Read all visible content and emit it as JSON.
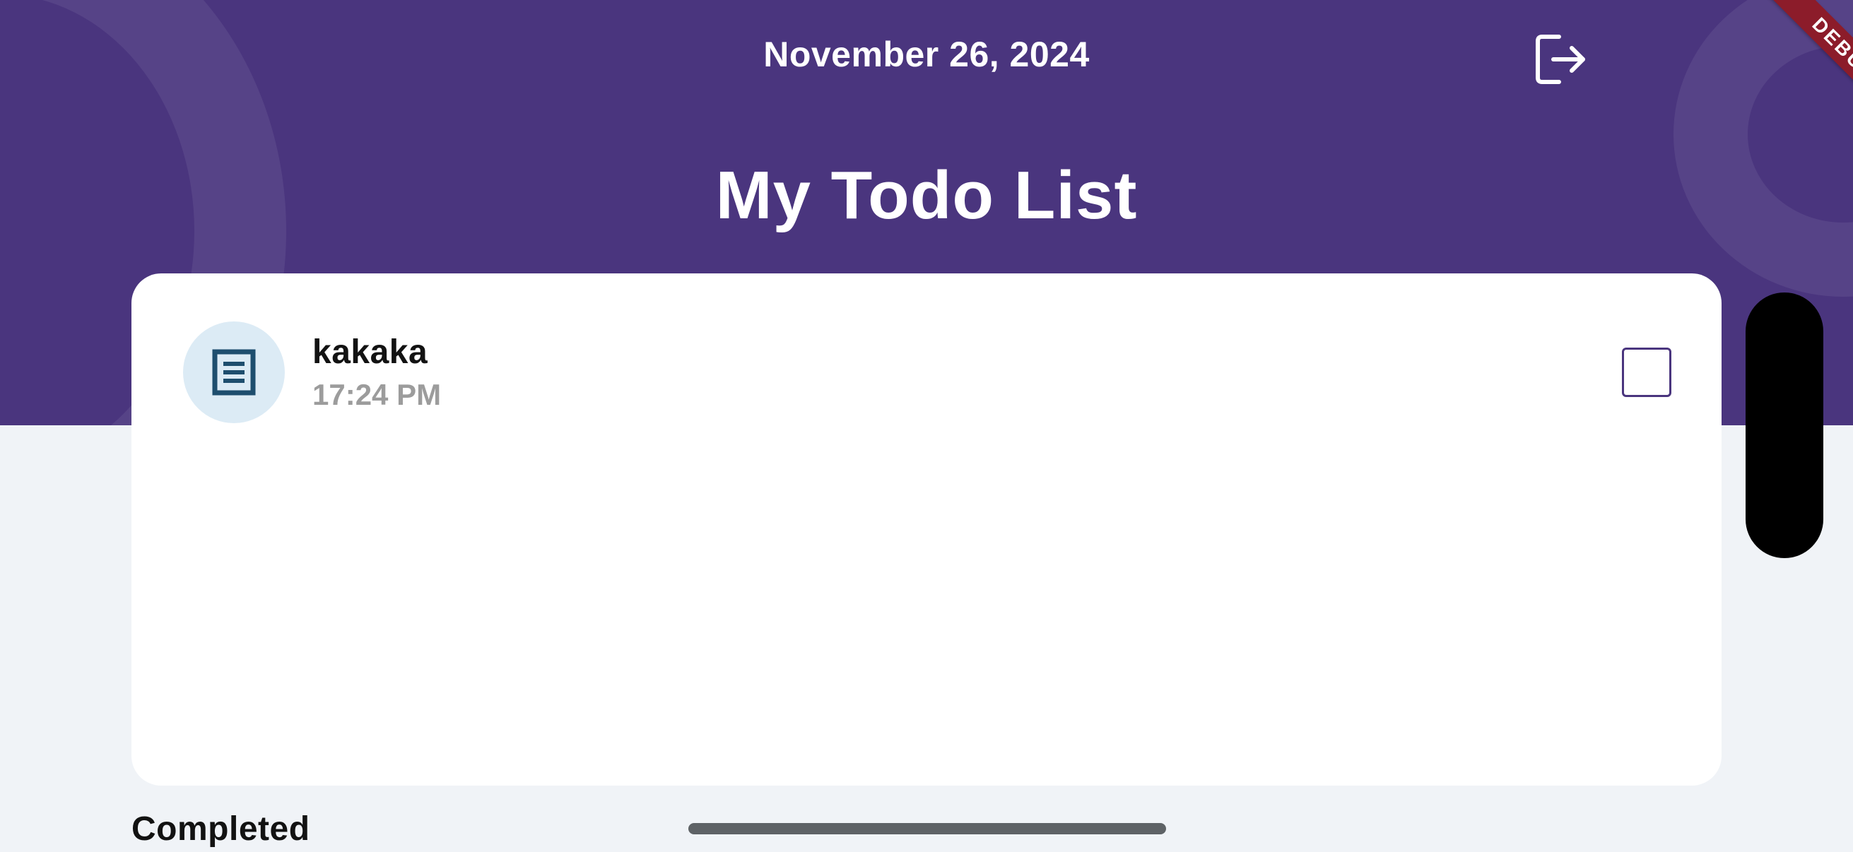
{
  "header": {
    "date": "November 26, 2024",
    "title": "My Todo List",
    "logout_icon": "logout-icon"
  },
  "todos": [
    {
      "title": "kakaka",
      "time": "17:24 PM",
      "icon": "note-icon",
      "completed": false
    }
  ],
  "sections": {
    "completed_label": "Completed"
  },
  "debug_banner": "DEBUG",
  "colors": {
    "header_bg": "#4a357e",
    "page_bg": "#f0f3f7",
    "icon_circle_bg": "#dcebf5",
    "icon_color": "#1e4e6e",
    "debug_ribbon": "#8c1c2a"
  }
}
